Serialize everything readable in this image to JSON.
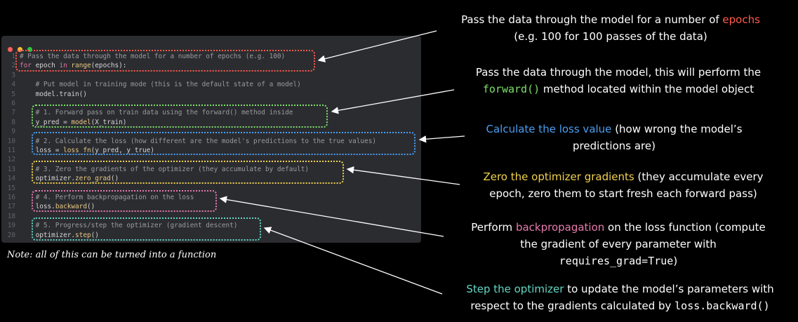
{
  "code": {
    "lines": [
      {
        "n": "1",
        "indent": "",
        "parts": [
          {
            "t": "# Pass the data through the model for a number of epochs (e.g. 100)",
            "c": "c"
          }
        ]
      },
      {
        "n": "2",
        "indent": "",
        "parts": [
          {
            "t": "for",
            "c": "kw"
          },
          {
            "t": " epoch ",
            "c": ""
          },
          {
            "t": "in",
            "c": "kw"
          },
          {
            "t": " ",
            "c": ""
          },
          {
            "t": "range",
            "c": "fn"
          },
          {
            "t": "(epochs):",
            "c": ""
          }
        ]
      },
      {
        "n": "3",
        "indent": "",
        "parts": []
      },
      {
        "n": "4",
        "indent": "    ",
        "parts": [
          {
            "t": "# Put model in training mode (this is the default state of a model)",
            "c": "c"
          }
        ]
      },
      {
        "n": "5",
        "indent": "    ",
        "parts": [
          {
            "t": "model.train()",
            "c": ""
          }
        ]
      },
      {
        "n": "6",
        "indent": "",
        "parts": []
      },
      {
        "n": "7",
        "indent": "    ",
        "parts": [
          {
            "t": "# 1. Forward pass on train data using the forward() method inside",
            "c": "c"
          }
        ]
      },
      {
        "n": "8",
        "indent": "    ",
        "parts": [
          {
            "t": "y_pred = ",
            "c": ""
          },
          {
            "t": "model",
            "c": "fn"
          },
          {
            "t": "(X_train)",
            "c": ""
          }
        ]
      },
      {
        "n": "9",
        "indent": "",
        "parts": []
      },
      {
        "n": "10",
        "indent": "    ",
        "parts": [
          {
            "t": "# 2. Calculate the loss (how different are the model's predictions to the true values)",
            "c": "c"
          }
        ]
      },
      {
        "n": "11",
        "indent": "    ",
        "parts": [
          {
            "t": "loss = ",
            "c": ""
          },
          {
            "t": "loss_fn",
            "c": "fn"
          },
          {
            "t": "(y_pred, y_true)",
            "c": ""
          }
        ]
      },
      {
        "n": "12",
        "indent": "",
        "parts": []
      },
      {
        "n": "13",
        "indent": "    ",
        "parts": [
          {
            "t": "# 3. Zero the gradients of the optimizer (they accumulate by default)",
            "c": "c"
          }
        ]
      },
      {
        "n": "14",
        "indent": "    ",
        "parts": [
          {
            "t": "optimizer.",
            "c": ""
          },
          {
            "t": "zero_grad",
            "c": "fn"
          },
          {
            "t": "()",
            "c": ""
          }
        ]
      },
      {
        "n": "15",
        "indent": "",
        "parts": []
      },
      {
        "n": "16",
        "indent": "    ",
        "parts": [
          {
            "t": "# 4. Perform backpropagation on the loss",
            "c": "c"
          }
        ]
      },
      {
        "n": "17",
        "indent": "    ",
        "parts": [
          {
            "t": "loss.",
            "c": ""
          },
          {
            "t": "backward",
            "c": "fn"
          },
          {
            "t": "()",
            "c": ""
          }
        ]
      },
      {
        "n": "18",
        "indent": "",
        "parts": []
      },
      {
        "n": "19",
        "indent": "    ",
        "parts": [
          {
            "t": "# 5. Progress/step the optimizer (gradient descent)",
            "c": "c"
          }
        ]
      },
      {
        "n": "20",
        "indent": "    ",
        "parts": [
          {
            "t": "optimizer.",
            "c": ""
          },
          {
            "t": "step",
            "c": "fn"
          },
          {
            "t": "()",
            "c": ""
          }
        ]
      }
    ]
  },
  "annotations": {
    "epochs": {
      "pre": "Pass the data through the model for a number of ",
      "hl": "epochs",
      "hl_color": "#ff5a4e",
      "post": "",
      "line2": "(e.g. 100 for 100 passes of the data)"
    },
    "forward": {
      "line1": "Pass the data through the model, this will perform the",
      "code": "forward()",
      "code_color": "#7ee06a",
      "post": " method located within the model object"
    },
    "loss": {
      "hl": "Calculate the loss value",
      "hl_color": "#4a9ff2",
      "post": " (how wrong the model’s",
      "line2": "predictions are)"
    },
    "zero": {
      "hl": "Zero the optimizer gradients",
      "hl_color": "#f2d14e",
      "post": " (they accumulate every",
      "line2": "epoch, zero them to start fresh each forward pass)"
    },
    "backprop": {
      "pre": "Perform ",
      "hl": "backpropagation",
      "hl_color": "#e77ab0",
      "post": " on the loss function (compute",
      "line2": "the gradient of every parameter with",
      "code": "requires_grad=True",
      "post2": ")"
    },
    "step": {
      "hl": "Step the optimizer",
      "hl_color": "#63d6c4",
      "post": " to update the model’s parameters with",
      "line2": "respect to the gradients calculated by ",
      "code": "loss.backward()"
    }
  },
  "note": "Note: all of this can be turned into a function",
  "colors": {
    "red": "#ff5a4e",
    "green": "#7ee06a",
    "blue": "#4a9ff2",
    "yellow": "#f2d14e",
    "pink": "#e77ab0",
    "teal": "#63d6c4"
  }
}
